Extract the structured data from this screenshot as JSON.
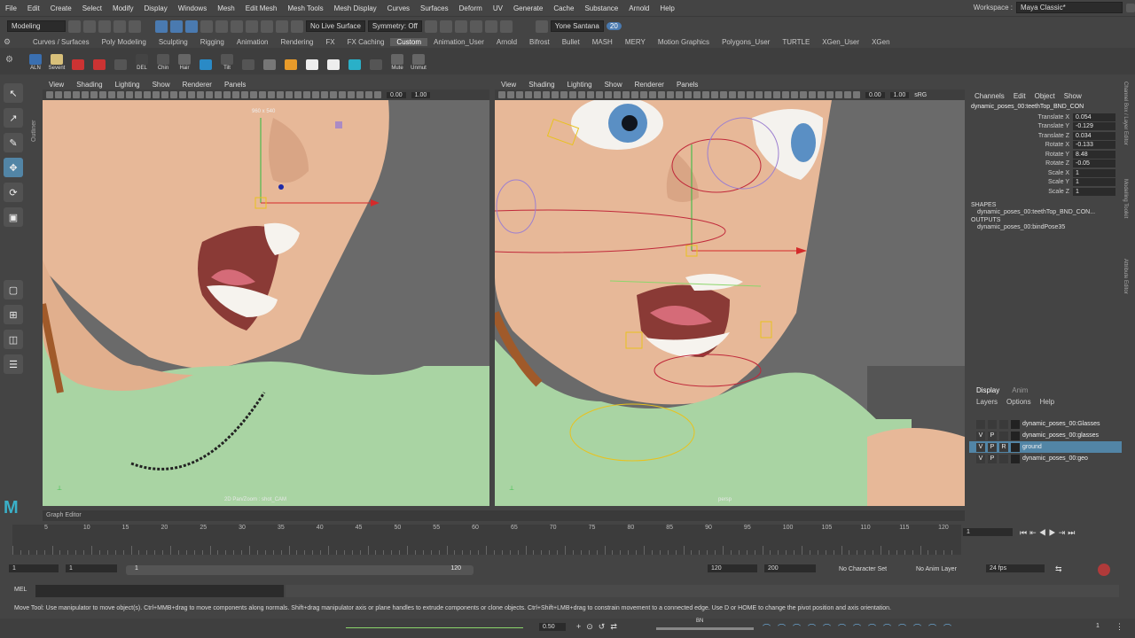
{
  "menubar": {
    "items": [
      "File",
      "Edit",
      "Create",
      "Select",
      "Modify",
      "Display",
      "Windows",
      "Mesh",
      "Edit Mesh",
      "Mesh Tools",
      "Mesh Display",
      "Curves",
      "Surfaces",
      "Deform",
      "UV",
      "Generate",
      "Cache",
      "Substance",
      "Arnold",
      "Help"
    ],
    "workspace_label": "Workspace :",
    "workspace_value": "Maya Classic*"
  },
  "statusline": {
    "mode": "Modeling",
    "live": "No Live Surface",
    "symmetry": "Symmetry: Off",
    "user": "Yone Santana",
    "notifications": "20"
  },
  "shelf": {
    "tabs": [
      "Curves / Surfaces",
      "Poly Modeling",
      "Sculpting",
      "Rigging",
      "Animation",
      "Rendering",
      "FX",
      "FX Caching",
      "Custom",
      "Animation_User",
      "Arnold",
      "Bifrost",
      "Bullet",
      "MASH",
      "MERY",
      "Motion Graphics",
      "Polygons_User",
      "TURTLE",
      "XGen_User",
      "XGen"
    ],
    "active_tab": "Custom",
    "buttons": [
      {
        "label": "ALN"
      },
      {
        "label": "Sevent"
      },
      {
        "label": ""
      },
      {
        "label": ""
      },
      {
        "label": ""
      },
      {
        "label": "DEL"
      },
      {
        "label": "Chin"
      },
      {
        "label": "Hair"
      },
      {
        "label": ""
      },
      {
        "label": "Tilt"
      },
      {
        "label": ""
      },
      {
        "label": ""
      },
      {
        "label": ""
      },
      {
        "label": ""
      },
      {
        "label": ""
      },
      {
        "label": ""
      },
      {
        "label": ""
      },
      {
        "label": "Mute"
      },
      {
        "label": "Unmut"
      }
    ]
  },
  "panel_left": {
    "menus": [
      "View",
      "Shading",
      "Lighting",
      "Show",
      "Renderer",
      "Panels"
    ],
    "value_a": "0.00",
    "value_b": "1.00",
    "res_label": "960 x 540",
    "cam_label": "2D Pan/Zoom : shot_CAM"
  },
  "panel_right": {
    "menus": [
      "View",
      "Shading",
      "Lighting",
      "Show",
      "Renderer",
      "Panels"
    ],
    "value_a": "0.00",
    "value_b": "1.00",
    "cam_label": "persp",
    "extra": "sRG"
  },
  "outliner_label": "Outliner",
  "channelbox": {
    "menus": [
      "Channels",
      "Edit",
      "Object",
      "Show"
    ],
    "object": "dynamic_poses_00:teethTop_BND_CON",
    "attrs": [
      {
        "n": "Translate X",
        "v": "0.054"
      },
      {
        "n": "Translate Y",
        "v": "-0.129"
      },
      {
        "n": "Translate Z",
        "v": "0.034"
      },
      {
        "n": "Rotate X",
        "v": "-0.133"
      },
      {
        "n": "Rotate Y",
        "v": "8.48"
      },
      {
        "n": "Rotate Z",
        "v": "-0.05"
      },
      {
        "n": "Scale X",
        "v": "1"
      },
      {
        "n": "Scale Y",
        "v": "1"
      },
      {
        "n": "Scale Z",
        "v": "1"
      }
    ],
    "shapes_label": "SHAPES",
    "shape": "dynamic_poses_00:teethTop_BND_CON...",
    "outputs_label": "OUTPUTS",
    "output": "dynamic_poses_00:bindPose35",
    "side_tabs": [
      "Channel Box / Layer Editor",
      "Modelling Toolkit",
      "Attribute Editor"
    ]
  },
  "layers": {
    "tabs": [
      "Display",
      "Anim"
    ],
    "menus": [
      "Layers",
      "Options",
      "Help"
    ],
    "rows": [
      {
        "v": "",
        "p": "",
        "r": "",
        "name": "dynamic_poses_00:Glasses"
      },
      {
        "v": "V",
        "p": "P",
        "r": "",
        "name": "dynamic_poses_00:glasses"
      },
      {
        "v": "V",
        "p": "P",
        "r": "R",
        "name": "ground"
      },
      {
        "v": "V",
        "p": "P",
        "r": "",
        "name": "dynamic_poses_00:geo"
      }
    ],
    "selected": 2
  },
  "graph_editor_label": "Graph Editor",
  "timeline": {
    "ticks": [
      "5",
      "10",
      "15",
      "20",
      "25",
      "30",
      "35",
      "40",
      "45",
      "50",
      "55",
      "60",
      "65",
      "70",
      "75",
      "80",
      "85",
      "90",
      "95",
      "100",
      "105",
      "110",
      "115",
      "120"
    ],
    "current": "1"
  },
  "range": {
    "start": "1",
    "inner_start": "1",
    "slider_start": "1",
    "slider_end": "120",
    "end": "120",
    "max": "200",
    "char_set": "No Character Set",
    "anim_layer": "No Anim Layer",
    "fps": "24 fps"
  },
  "mel": {
    "label": "MEL"
  },
  "help_line": "Move Tool: Use manipulator to move object(s). Ctrl+MMB+drag to move components along normals. Shift+drag manipulator axis or plane handles to extrude components or clone objects. Ctrl+Shift+LMB+drag to constrain movement to a connected edge. Use D or HOME to change the pivot position and axis orientation.",
  "bottombar": {
    "value": "0.50",
    "label": "BN",
    "count": "1"
  },
  "colors": {
    "skin": "#e7b898",
    "shirt": "#a9d4a3",
    "bg": "#6a6a6a",
    "accent": "#5285a6"
  }
}
